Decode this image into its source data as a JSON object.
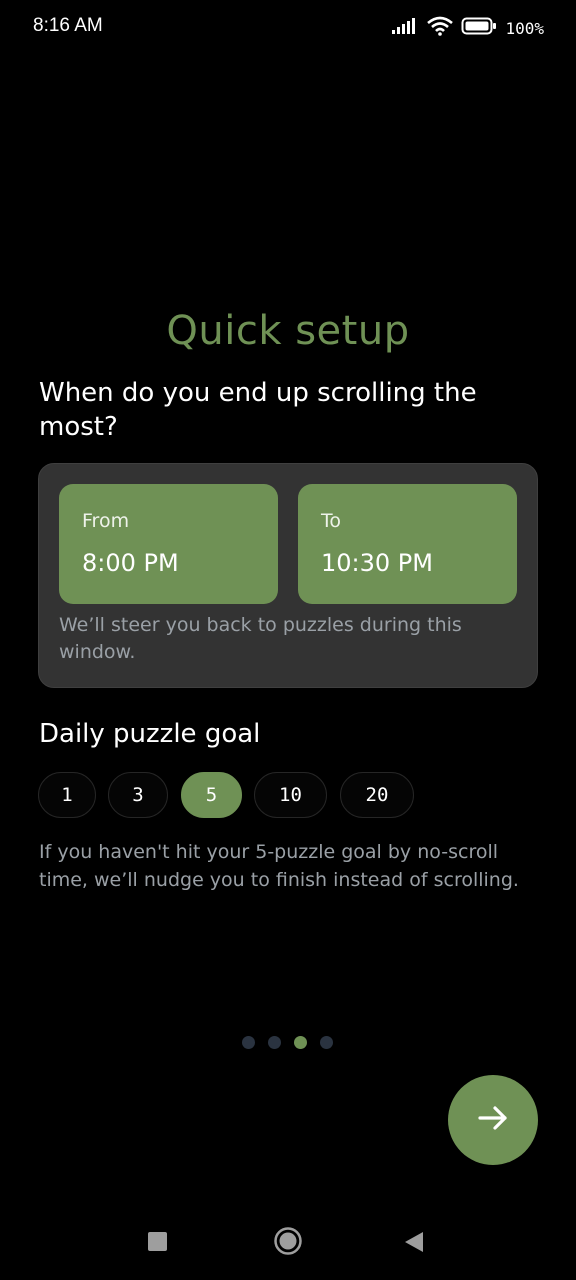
{
  "status_bar": {
    "time": "8:16 AM",
    "battery": "100%",
    "icons": [
      "signal-icon",
      "wifi-icon",
      "battery-icon"
    ]
  },
  "screen": {
    "title": "Quick setup",
    "question": "When do you end up scrolling the most?"
  },
  "time_window": {
    "from_label": "From",
    "from_value": "8:00 PM",
    "to_label": "To",
    "to_value": "10:30 PM",
    "note": "We’ll steer you back to puzzles during this window."
  },
  "goal": {
    "title": "Daily puzzle goal",
    "options": [
      "1",
      "3",
      "5",
      "10",
      "20"
    ],
    "selected": "5",
    "note": "If you haven't hit your 5-puzzle goal by no-scroll time, we’ll nudge you to finish instead of scrolling."
  },
  "pager": {
    "total": 4,
    "current": 3
  },
  "next_button": {
    "icon": "arrow-right-icon"
  },
  "nav_bar": {
    "icons": [
      "recents-square-icon",
      "home-circle-icon",
      "back-triangle-icon"
    ]
  },
  "colors": {
    "background": "#000000",
    "accent": "#6f9155",
    "card": "#333333",
    "muted_text": "#9aa0a6",
    "dot_inactive": "#2a3340"
  }
}
